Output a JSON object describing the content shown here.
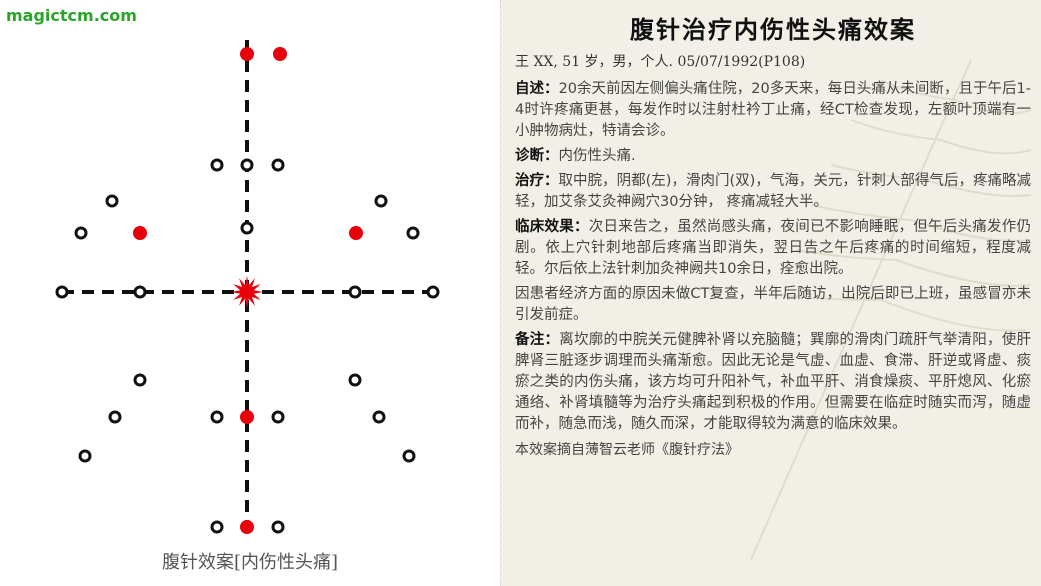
{
  "site": "magictcm.com",
  "diagram": {
    "caption": "腹针效案[内伤性头痛]",
    "colors": {
      "selected": "#e8000a",
      "unselected": "#111111",
      "center": "#e8000a"
    }
  },
  "title": "腹针治疗内伤性头痛效案",
  "patient": "王 XX, 51 岁，男，个人.  05/07/1992(P108)",
  "sections": {
    "complaint": {
      "label": "自述：",
      "text": "20余天前因左侧偏头痛住院，20多天来，每日头痛从未间断，且于午后1-4时许疼痛更甚，每发作时以注射杜衿丁止痛，经CT检查发现，左额叶顶端有一小肿物病灶，特请会诊。"
    },
    "diagnosis": {
      "label": "诊断：",
      "text": "内伤性头痛."
    },
    "treatment": {
      "label": "治疗：",
      "text": "取中脘，阴都(左)，滑肉门(双)，气海，关元，针刺人部得气后，疼痛略减轻，加艾条艾灸神阙穴30分钟，  疼痛减轻大半。"
    },
    "effect": {
      "label": "临床效果：",
      "text": "次日来告之，虽然尚感头痛，夜间已不影响睡眠，但午后头痛发作仍剧。依上穴针刺地部后疼痛当即消失，翌日告之午后疼痛的时间缩短，程度减轻。尔后依上法针刺加灸神阙共10余日，痊愈出院。"
    },
    "followup": {
      "text": "因患者经济方面的原因未做CT复查，半年后随访，出院后即已上班，虽感冒亦未引发前症。"
    },
    "notes": {
      "label": "备注：",
      "text": "离坎廓的中脘关元健脾补肾以充脑髓；巽廓的滑肉门疏肝气举清阳，使肝脾肾三脏逐步调理而头痛渐愈。因此无论是气虚、血虚、食滞、肝逆或肾虚、痰瘀之类的内伤头痛，该方均可升阳补气，补血平肝、消食燥痰、平肝熄风、化瘀通络、补肾填髓等为治疗头痛起到积极的作用。但需要在临症时随实而泻，随虚而补，随急而浅，随久而深，才能取得较为满意的临床效果。"
    }
  },
  "source": "本效案摘自薄智云老师《腹针疗法》"
}
